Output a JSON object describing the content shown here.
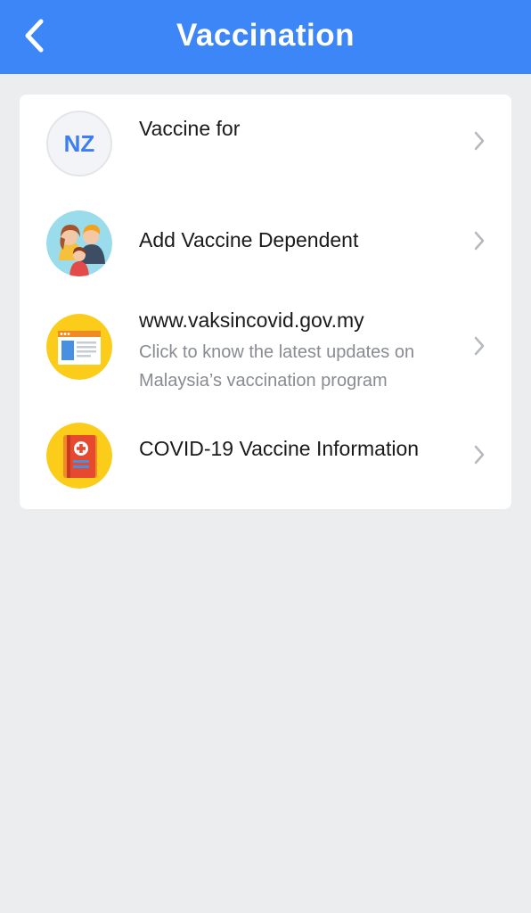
{
  "header": {
    "title": "Vaccination",
    "back_icon": "chevron-left-icon",
    "color": "#3d86f7"
  },
  "menu": {
    "items": [
      {
        "avatar_initials": "NZ",
        "label": "Vaccine for",
        "icon": "initials-avatar"
      },
      {
        "label": "Add Vaccine Dependent",
        "icon": "family-icon"
      },
      {
        "label": "www.vaksincovid.gov.my",
        "description": "Click to know the latest updates on Malaysia’s vaccination program",
        "icon": "browser-window-icon"
      },
      {
        "label": "COVID-19 Vaccine Information",
        "icon": "medical-booklet-icon"
      }
    ]
  }
}
